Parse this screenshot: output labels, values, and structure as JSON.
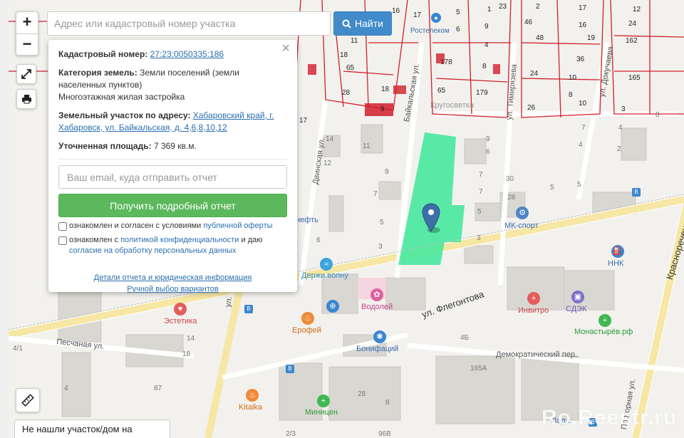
{
  "toolbar": {
    "zoom_in": "+",
    "zoom_out": "−",
    "search_placeholder": "Адрес или кадастровый номер участка",
    "search_button": "Найти"
  },
  "popup": {
    "close": "×",
    "cadastral_label": "Кадастровый номер:",
    "cadastral_value": "27:23:0050335:186",
    "category_label": "Категория земель:",
    "category_value": "Земли поселений (земли населенных пунктов)",
    "usage_value": "Многоэтажная жилая застройка",
    "address_label": "Земельный участок по адресу:",
    "address_value": "Хабаровский край, г. Хабаровск, ул. Байкальская, д. 4,6,8,10,12",
    "area_label": "Уточненная площадь:",
    "area_value": "7 369 кв.м.",
    "email_placeholder": "Ваш email, куда отправить отчет",
    "report_button": "Получить подробный отчет",
    "agree1_text": "ознакомлен и согласен с условиями",
    "agree1_link": "публичной оферты",
    "agree2_text": "ознакомлен с",
    "agree2_link": "политикой конфиденциальности",
    "agree2_mid": "и даю",
    "agree2_link2": "согласие на обработку персональных данных",
    "details_link": "Детали отчета и юридическая информация",
    "manual_link": "Ручной выбор вариантов"
  },
  "footer": {
    "not_found": "Не нашли участок/дом на карте?",
    "watermark": "Ro.Reestr.ru"
  },
  "map": {
    "streets": {
      "baikalskaya": "Байкальская ул.",
      "dvinskaya": "Двинская ул.",
      "timiryazeva": "ул. Тимирязева",
      "dokuchaeva": "ул. Докучаева",
      "flegontova": "ул. Флегонтова",
      "krasnorechenskaya": "Краснореченская ул.",
      "pesochnaya": "Песчаная ул.",
      "demokraticheskiy": "Демократический пер.",
      "podrozhnaya": "Подгорная ул.",
      "ul": "ул."
    },
    "pois": {
      "mk_sport": "МК-спорт",
      "derzhi_volnu": "Держи волну",
      "vodoley": "Водолей",
      "invitro": "Инвитро",
      "sdek": "СДЭК",
      "nnk": "ННК",
      "monastyrev": "Монастырёв.рф",
      "estetika": "Эстетика",
      "erofey": "Ерофей",
      "bonifatsiy": "Бонифаций",
      "kitaika": "Kitaika",
      "minitsen": "Миницен",
      "krugosvetka": "Кругосветка",
      "rsk": "Ростелеком",
      "neft": "нефть",
      "lada": "Лада"
    },
    "parcel_numbers": [
      "16",
      "17",
      "11",
      "9",
      "6",
      "5",
      "4",
      "1",
      "23",
      "2",
      "46",
      "17",
      "16",
      "12",
      "24",
      "48",
      "19",
      "162",
      "178",
      "8",
      "24",
      "10",
      "36",
      "165",
      "65",
      "18",
      "28",
      "18",
      "9",
      "65",
      "179",
      "26",
      "10",
      "8",
      "3",
      "17",
      "14",
      "11",
      "12",
      "9",
      "7",
      "5",
      "3",
      "6",
      "7",
      "6",
      "9",
      "7",
      "5",
      "4",
      "3",
      "30",
      "28",
      "2",
      "5",
      "5",
      "8",
      "7",
      "4",
      "14",
      "28",
      "4Б",
      "165А",
      "96В",
      "87",
      "4",
      "18",
      "4/1",
      "2/3",
      "8"
    ]
  },
  "colors": {
    "parcel_line": "#d21f2c",
    "selected_parcel": "#3ee89a",
    "marker": "#3d6fa8",
    "search_btn": "#428bca",
    "report_btn": "#5cb85c"
  }
}
